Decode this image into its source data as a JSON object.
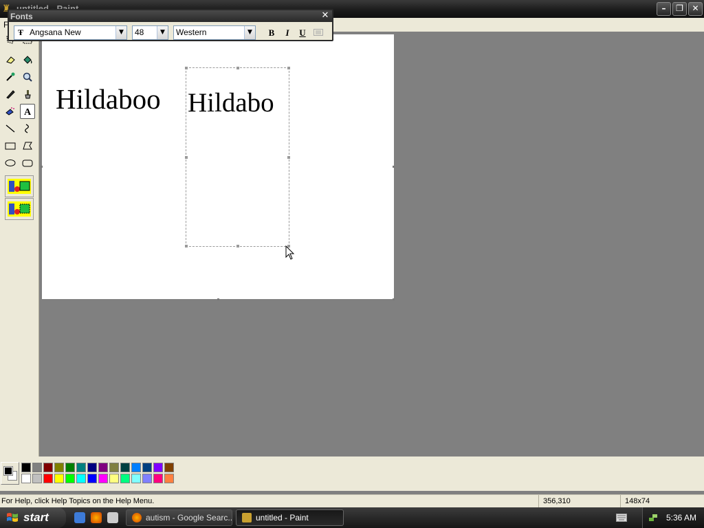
{
  "window": {
    "title": "untitled - Paint",
    "minimize": "–",
    "restore": "❐",
    "close": "✕"
  },
  "menu": {
    "file_fragment": "F"
  },
  "fonts_toolbar": {
    "title": "Fonts",
    "close": "✕",
    "font_name": "Angsana New",
    "font_type_glyph": "Ŧ",
    "font_size": "48",
    "script": "Western",
    "bold": "B",
    "italic": "I",
    "underline": "U"
  },
  "tools": [
    "free-form-select",
    "select",
    "eraser",
    "fill-with-color",
    "pick-color",
    "magnifier",
    "pencil",
    "brush",
    "airbrush",
    "text",
    "line",
    "curve",
    "rectangle",
    "polygon",
    "ellipse",
    "rounded-rectangle"
  ],
  "selected_tool": "text",
  "canvas": {
    "text_existing": "Hildaboo",
    "text_editing": "Hildabo"
  },
  "palette": {
    "foreground": "#000000",
    "background": "#ffffff",
    "top_row": [
      "#000000",
      "#808080",
      "#800000",
      "#808000",
      "#008000",
      "#008080",
      "#000080",
      "#800080",
      "#808040",
      "#004040",
      "#0080ff",
      "#004080",
      "#8000ff",
      "#804000"
    ],
    "bottom_row": [
      "#ffffff",
      "#c0c0c0",
      "#ff0000",
      "#ffff00",
      "#00ff00",
      "#00ffff",
      "#0000ff",
      "#ff00ff",
      "#ffff80",
      "#00ff80",
      "#80ffff",
      "#8080ff",
      "#ff0080",
      "#ff8040"
    ]
  },
  "status": {
    "help": "For Help, click Help Topics on the Help Menu.",
    "coords": "356,310",
    "size": "148x74"
  },
  "taskbar": {
    "start": "start",
    "tasks": [
      {
        "label": "autism - Google Searc...",
        "active": false
      },
      {
        "label": "untitled - Paint",
        "active": true
      }
    ],
    "clock": "5:36 AM"
  }
}
